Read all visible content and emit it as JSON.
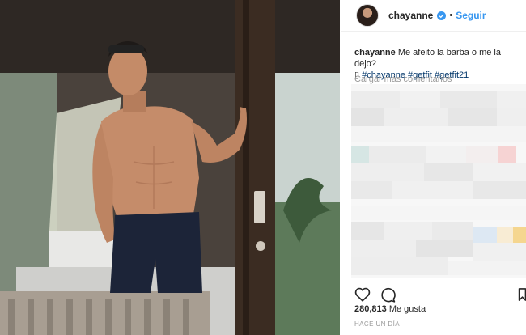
{
  "post": {
    "username": "chayanne",
    "follow_label": "Seguir",
    "separator": "•",
    "caption": {
      "user": "chayanne",
      "text": "Me afeito la barba o me la dejo?",
      "glyph": "▯",
      "hashtags": [
        "#chayanne",
        "#getfit",
        "#getfit21"
      ]
    },
    "load_more_label": "Cargar más comentarios",
    "likes_count": "280,813",
    "likes_label": "Me gusta",
    "timestamp": "HACE UN DÍA"
  },
  "colors": {
    "link_blue": "#3897f0",
    "hashtag_blue": "#003569",
    "muted_gray": "#999999",
    "text_dark": "#262626",
    "border": "#efefef"
  },
  "icons": [
    "verified-badge-icon",
    "heart-icon",
    "comment-icon",
    "bookmark-icon"
  ]
}
